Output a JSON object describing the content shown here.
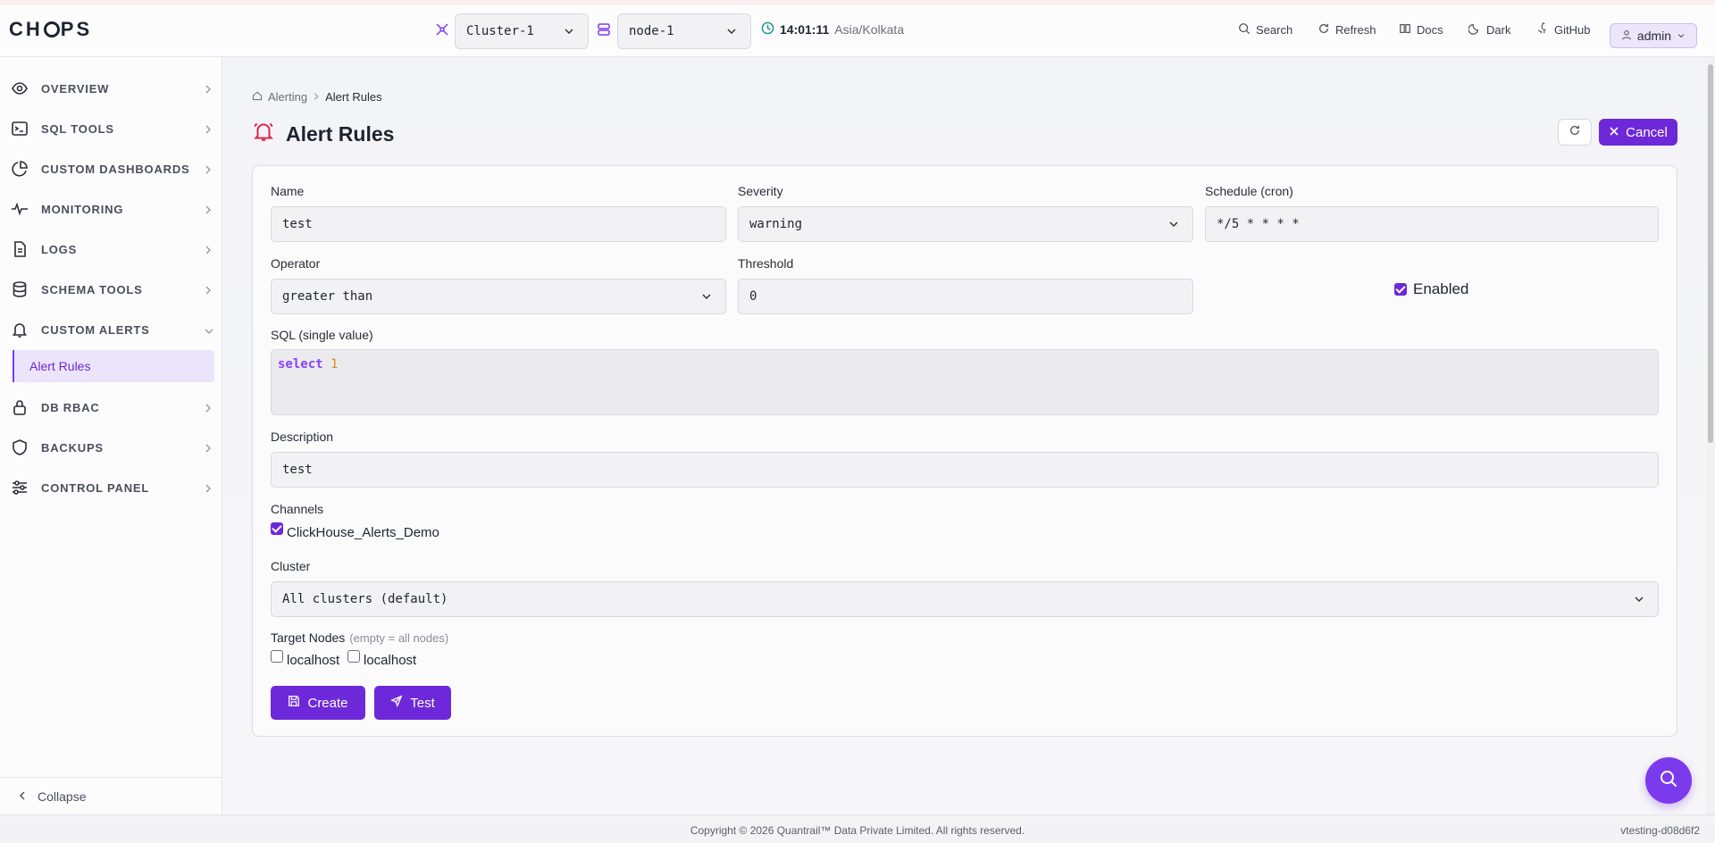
{
  "app": {
    "logo": "CHOPS"
  },
  "header": {
    "cluster_select": "Cluster-1",
    "node_select": "node-1",
    "time": "14:01:11",
    "timezone": "Asia/Kolkata",
    "nav": {
      "search": "Search",
      "refresh": "Refresh",
      "docs": "Docs",
      "theme": "Dark",
      "github": "GitHub"
    },
    "user": "admin"
  },
  "sidebar": {
    "items": [
      {
        "label": "OVERVIEW",
        "icon": "eye-icon"
      },
      {
        "label": "SQL TOOLS",
        "icon": "terminal-icon"
      },
      {
        "label": "CUSTOM DASHBOARDS",
        "icon": "pie-chart-icon"
      },
      {
        "label": "MONITORING",
        "icon": "activity-icon"
      },
      {
        "label": "LOGS",
        "icon": "file-text-icon"
      },
      {
        "label": "SCHEMA TOOLS",
        "icon": "database-icon"
      },
      {
        "label": "CUSTOM ALERTS",
        "icon": "bell-icon"
      },
      {
        "label": "DB RBAC",
        "icon": "lock-icon"
      },
      {
        "label": "BACKUPS",
        "icon": "shield-icon"
      },
      {
        "label": "CONTROL PANEL",
        "icon": "sliders-icon"
      }
    ],
    "active_sub": "Alert Rules",
    "collapse": "Collapse"
  },
  "breadcrumb": {
    "parent": "Alerting",
    "current": "Alert Rules"
  },
  "page": {
    "title": "Alert Rules",
    "cancel": "Cancel"
  },
  "form": {
    "name_label": "Name",
    "name_value": "test",
    "severity_label": "Severity",
    "severity_value": "warning",
    "schedule_label": "Schedule (cron)",
    "schedule_value": "*/5 * * * *",
    "operator_label": "Operator",
    "operator_value": "greater than",
    "threshold_label": "Threshold",
    "threshold_value": "0",
    "enabled_label": "Enabled",
    "sql_label": "SQL (single value)",
    "sql_keyword": "select",
    "sql_number": "1",
    "description_label": "Description",
    "description_value": "test",
    "channels_label": "Channels",
    "channel_1": "ClickHouse_Alerts_Demo",
    "cluster_label": "Cluster",
    "cluster_value": "All clusters (default)",
    "target_nodes_label": "Target Nodes",
    "target_nodes_hint": "(empty = all nodes)",
    "node_1": "localhost",
    "node_2": "localhost",
    "create_button": "Create",
    "test_button": "Test"
  },
  "footer": {
    "copyright": "Copyright © 2026 Quantrail™ Data Private Limited. All rights reserved.",
    "version": "vtesting-d08d6f2"
  },
  "colors": {
    "accent": "#6d28d9",
    "bell": "#e11d48"
  }
}
